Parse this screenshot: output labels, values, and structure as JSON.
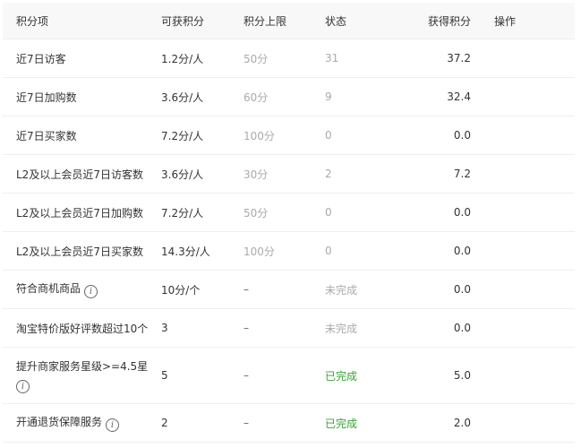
{
  "table": {
    "headers": {
      "item": "积分项",
      "points": "可获积分",
      "limit": "积分上限",
      "status": "状态",
      "earned": "获得积分",
      "action": "操作"
    },
    "rows": [
      {
        "item": "近7日访客",
        "points": "1.2分/人",
        "limit": "50分",
        "status": "31",
        "earned": "37.2"
      },
      {
        "item": "近7日加购数",
        "points": "3.6分/人",
        "limit": "60分",
        "status": "9",
        "earned": "32.4"
      },
      {
        "item": "近7日买家数",
        "points": "7.2分/人",
        "limit": "100分",
        "status": "0",
        "earned": "0.0"
      },
      {
        "item": "L2及以上会员近7日访客数",
        "points": "3.6分/人",
        "limit": "30分",
        "status": "2",
        "earned": "7.2"
      },
      {
        "item": "L2及以上会员近7日加购数",
        "points": "7.2分/人",
        "limit": "50分",
        "status": "0",
        "earned": "0.0"
      },
      {
        "item": "L2及以上会员近7日买家数",
        "points": "14.3分/人",
        "limit": "100分",
        "status": "0",
        "earned": "0.0"
      },
      {
        "item": "符合商机商品",
        "points": "10分/个",
        "limit": "–",
        "status": "未完成",
        "earned": "0.0",
        "info_icon": "info-icon"
      },
      {
        "item": "淘宝特价版好评数超过10个",
        "points": "3",
        "limit": "–",
        "status": "未完成",
        "earned": "0.0"
      },
      {
        "item": "提升商家服务星级>=4.5星",
        "points": "5",
        "limit": "–",
        "status": "已完成",
        "earned": "5.0",
        "info_icon": "info-icon"
      },
      {
        "item": "开通退货保障服务",
        "points": "2",
        "limit": "–",
        "status": "已完成",
        "earned": "2.0",
        "info_icon": "info-icon"
      }
    ]
  },
  "colors": {
    "header_bg": "#f8f8f8",
    "border": "#eeeeee",
    "text": "#333333",
    "muted": "#aaaaaa",
    "done": "#33a532"
  },
  "icon_glyph": "i"
}
